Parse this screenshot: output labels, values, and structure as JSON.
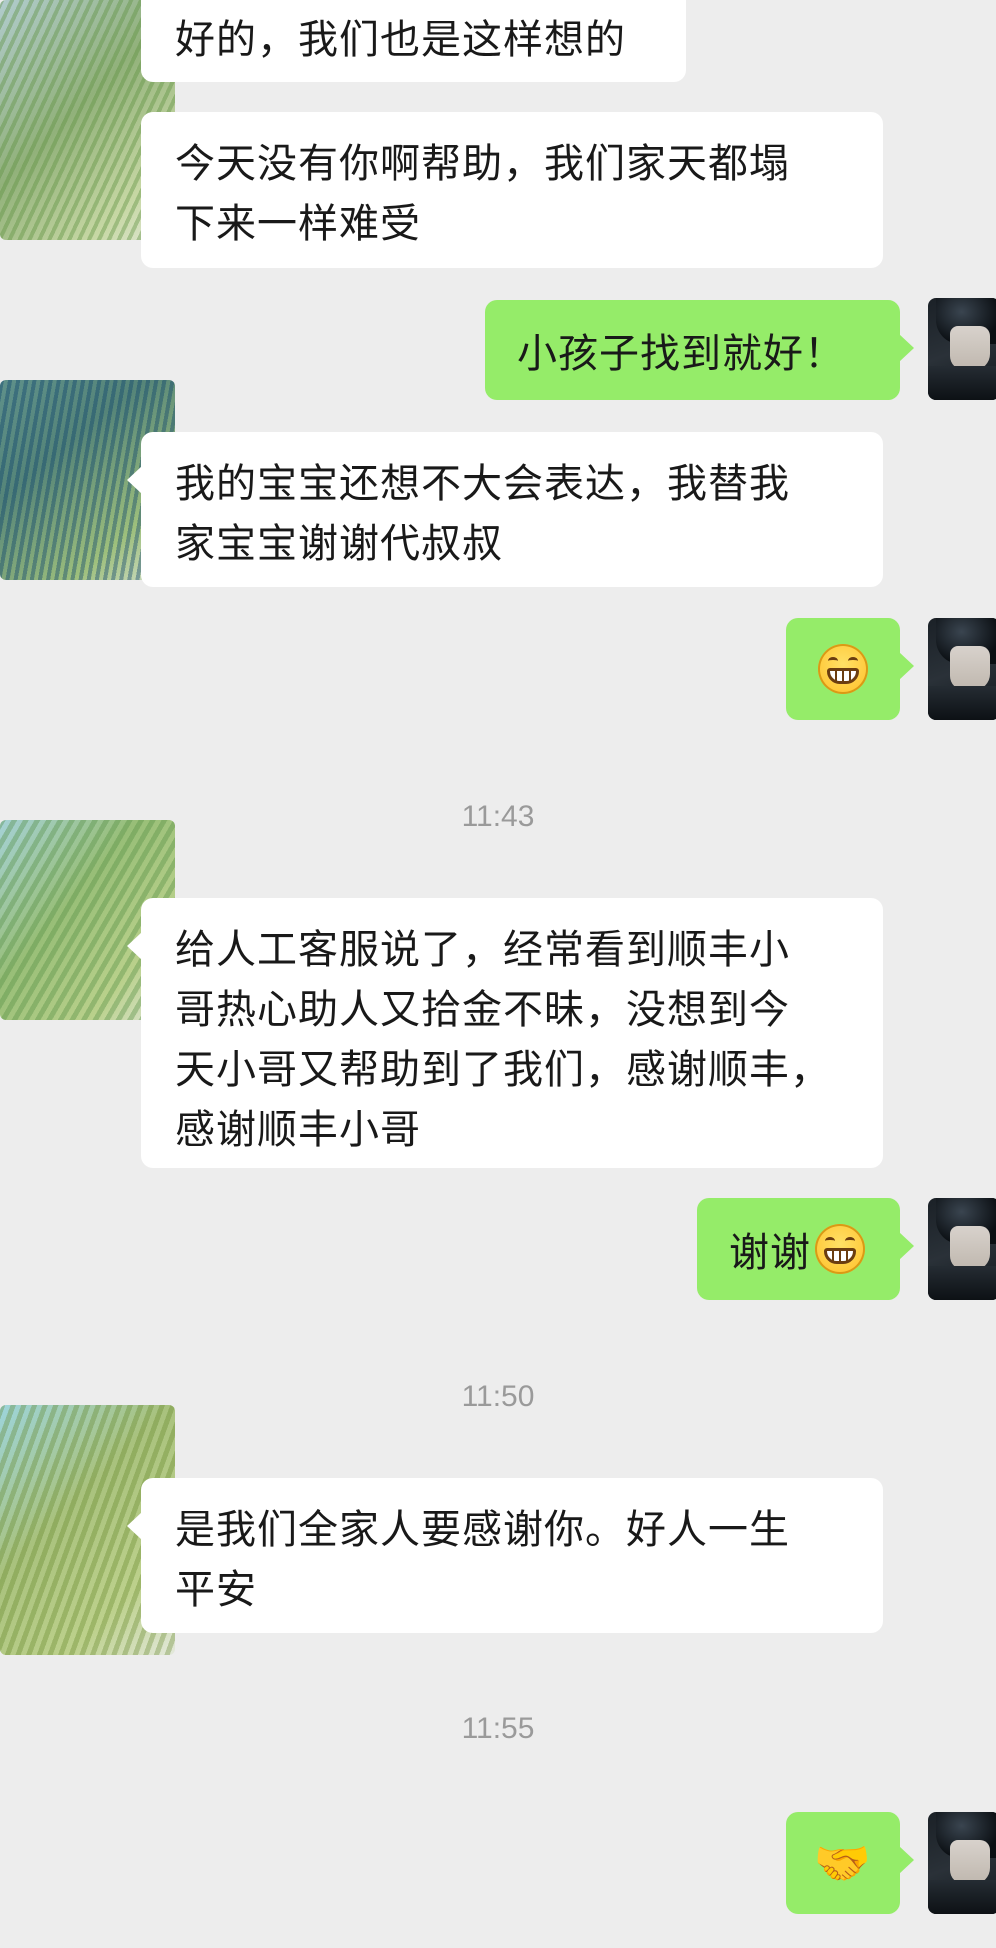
{
  "messages": [
    {
      "side": "left",
      "text": "好的，我们也是这样想的"
    },
    {
      "side": "left",
      "line1": "今天没有你啊帮助，我们家天都塌",
      "line2": "下来一样难受"
    },
    {
      "side": "right",
      "text": "小孩子找到就好！"
    },
    {
      "side": "left",
      "line1": "我的宝宝还想不大会表达，我替我",
      "line2": "家宝宝谢谢代叔叔"
    },
    {
      "side": "right",
      "emoji": "grinning-face-icon"
    },
    {
      "side": "left",
      "line1": "给人工客服说了，经常看到顺丰小",
      "line2": "哥热心助人又拾金不昧，没想到今",
      "line3": "天小哥又帮助到了我们，感谢顺丰，",
      "line4": "感谢顺丰小哥"
    },
    {
      "side": "right",
      "text": "谢谢",
      "emoji": "grinning-face-icon"
    },
    {
      "side": "left",
      "line1": "是我们全家人要感谢你。好人一生",
      "line2": "平安"
    },
    {
      "side": "right",
      "emoji": "handshake-icon",
      "emoji_glyph": "🤝"
    }
  ],
  "timestamps": [
    "11:43",
    "11:50",
    "11:55"
  ],
  "colors": {
    "background": "#ededed",
    "bubble_left": "#ffffff",
    "bubble_right": "#95ec69",
    "timestamp": "#9a9a9a"
  }
}
